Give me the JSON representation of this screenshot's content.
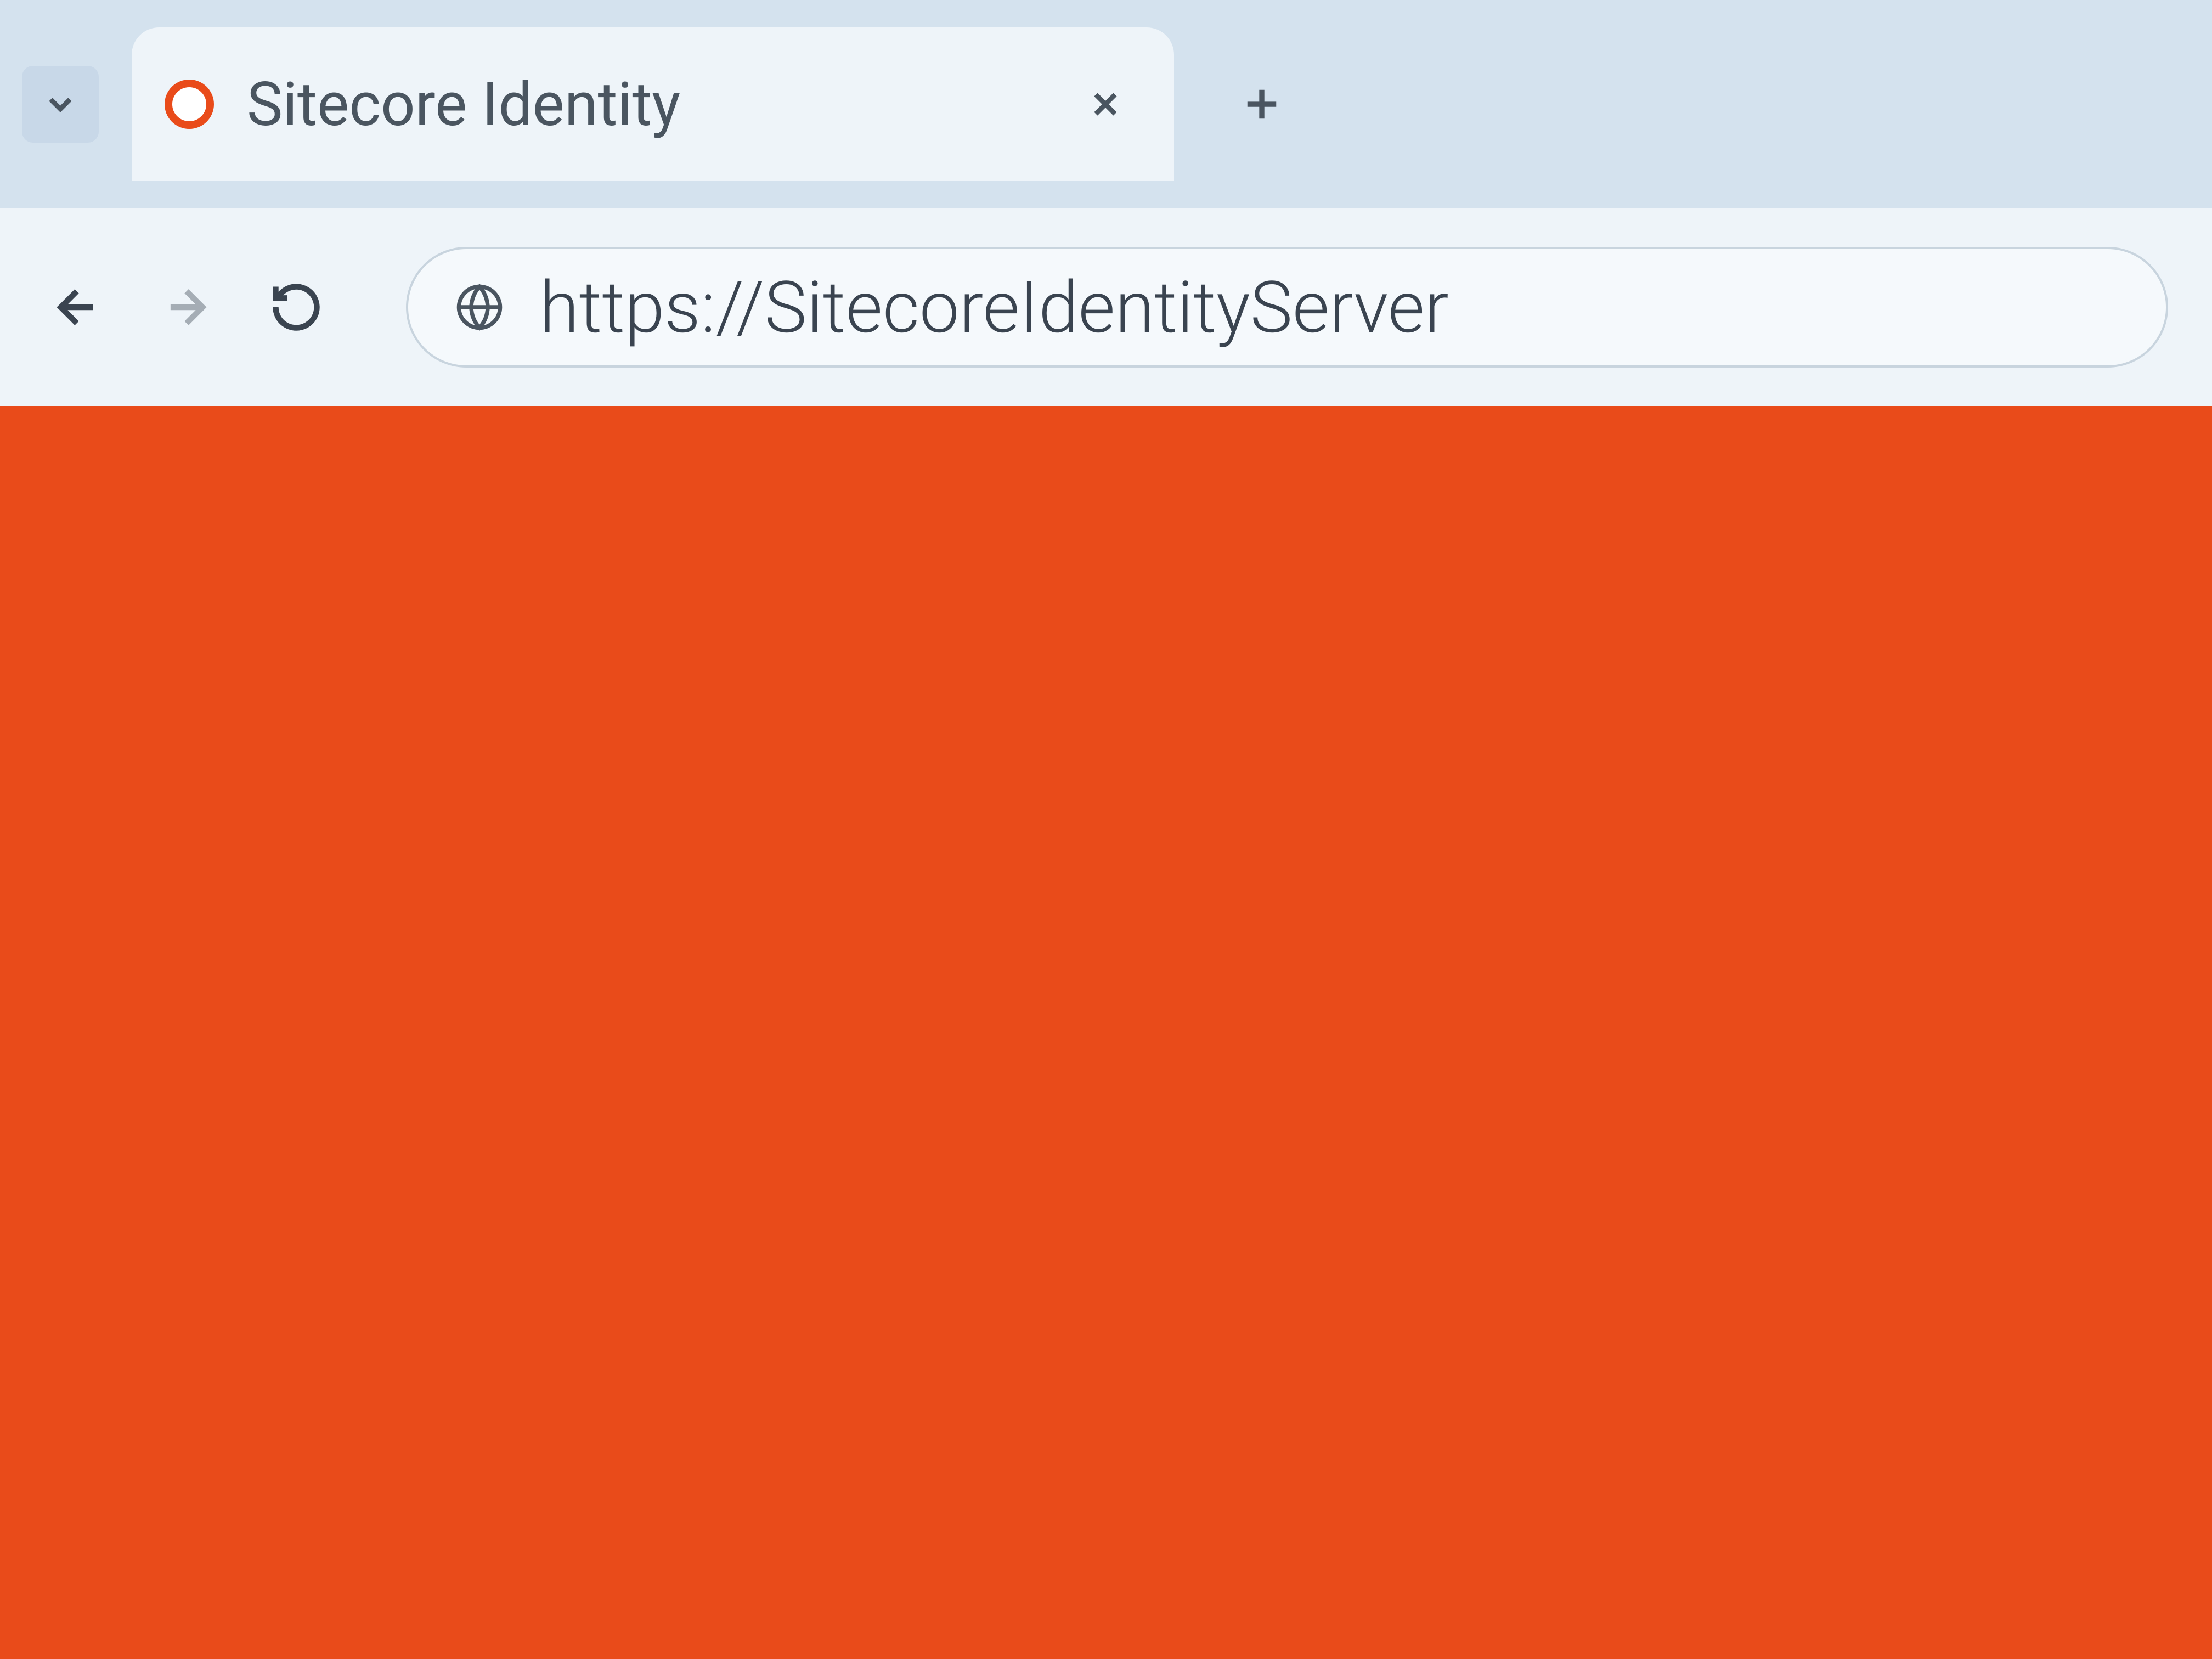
{
  "tab": {
    "title": "Sitecore Identity",
    "favicon_color": "#e94b1a"
  },
  "address_bar": {
    "url": "https://SitecoreIdentityServer"
  },
  "content": {
    "background_color": "#e94b1a"
  }
}
